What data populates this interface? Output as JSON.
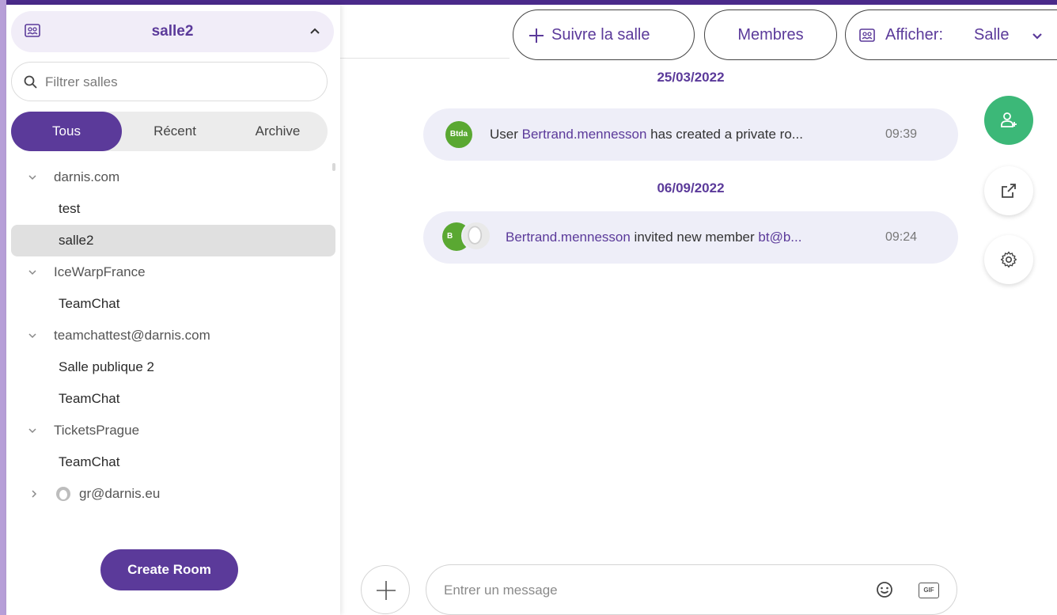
{
  "colors": {
    "accent": "#5b3a9a",
    "accent_light": "#f1edf8",
    "success": "#3cb878",
    "avatar_green": "#5aa832",
    "message_bg": "#eeeef8"
  },
  "sidebar": {
    "current_room": "salle2",
    "room_icon": "room-icon",
    "filter_placeholder": "Filtrer salles",
    "tabs": [
      {
        "label": "Tous",
        "active": true
      },
      {
        "label": "Récent",
        "active": false
      },
      {
        "label": "Archive",
        "active": false
      }
    ],
    "groups": [
      {
        "label": "darnis.com",
        "items": [
          {
            "label": "test",
            "selected": false
          },
          {
            "label": "salle2",
            "selected": true
          }
        ]
      },
      {
        "label": "IceWarpFrance",
        "items": [
          {
            "label": "TeamChat",
            "selected": false
          }
        ]
      },
      {
        "label": "teamchattest@darnis.com",
        "items": [
          {
            "label": "Salle publique 2",
            "selected": false
          },
          {
            "label": "TeamChat",
            "selected": false
          }
        ]
      },
      {
        "label": "TicketsPrague",
        "items": [
          {
            "label": "TeamChat",
            "selected": false
          }
        ]
      }
    ],
    "user_entry": {
      "label": "gr@darnis.eu",
      "expanded": false
    },
    "create_room_label": "Create Room"
  },
  "header": {
    "follow_label": "Suivre la salle",
    "members_label": "Membres",
    "display_label": "Afficher:",
    "display_value": "Salle"
  },
  "chat": {
    "messages": [
      {
        "date": "25/03/2022",
        "avatar_text": "Btda",
        "prefix": "User ",
        "name": "Bertrand.mennesson",
        "suffix": " has created a private ro...",
        "time": "09:39"
      },
      {
        "date": "06/09/2022",
        "avatar_text": "B",
        "prefix": "",
        "name": "Bertrand.mennesson",
        "middle": " invited new member ",
        "name2": "bt@b...",
        "time": "09:24"
      }
    ]
  },
  "actions": {
    "add_member_icon": "add-user-icon",
    "open_external_icon": "external-link-icon",
    "settings_icon": "gear-icon"
  },
  "composer": {
    "placeholder": "Entrer un message",
    "gif_label": "GIF"
  }
}
